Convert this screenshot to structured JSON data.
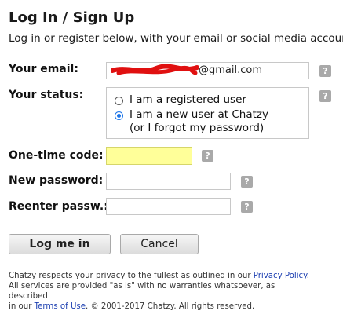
{
  "header": {
    "title": "Log In / Sign Up",
    "subtitle": "Log in or register below, with your email or social media account"
  },
  "form": {
    "email_label": "Your email:",
    "email_value_suffix": "@gmail.com",
    "status_label": "Your status:",
    "status_options": [
      {
        "label": "I am a registered user",
        "checked": false
      },
      {
        "label_line1": "I am a new user at Chatzy",
        "label_line2": "(or I forgot my password)",
        "checked": true
      }
    ],
    "code_label": "One-time code:",
    "code_value": "",
    "code_highlight": "#ffff99",
    "new_password_label": "New password:",
    "reenter_label": "Reenter passw.:",
    "help_glyph": "?"
  },
  "buttons": {
    "login": "Log me in",
    "cancel": "Cancel"
  },
  "footer": {
    "line1_pre": "Chatzy respects your privacy to the fullest as outlined in our ",
    "privacy_link": "Privacy Policy",
    "line1_post": ".",
    "line2": "All services are provided \"as is\" with no warranties whatsoever, as described",
    "line3_pre": "in our ",
    "terms_link": "Terms of Use",
    "line3_post": ". © 2001-2017 Chatzy. All rights reserved."
  },
  "colors": {
    "redaction": "#e01010",
    "link": "#1a3db0",
    "radio_accent": "#1a73e8"
  }
}
